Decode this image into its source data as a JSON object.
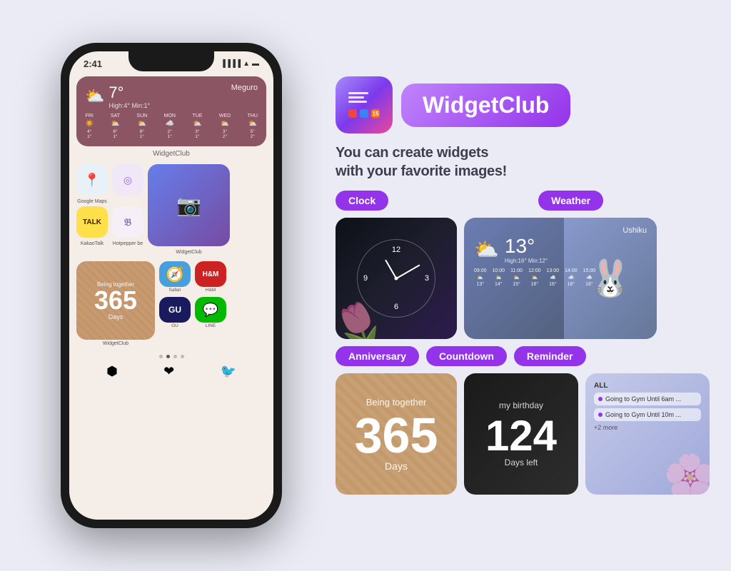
{
  "page": {
    "background_color": "#eaebf5"
  },
  "phone": {
    "time": "2:41",
    "weather_widget": {
      "temperature": "7°",
      "location": "Meguro",
      "high": "High:4°",
      "min": "Min:1°",
      "days": [
        {
          "name": "FRI",
          "icon": "☀",
          "high": "4°",
          "low": "1°"
        },
        {
          "name": "SAT",
          "icon": "⛅",
          "high": "6°",
          "low": "1°"
        },
        {
          "name": "SUN",
          "icon": "⛅",
          "high": "8°",
          "low": "1°"
        },
        {
          "name": "MON",
          "icon": "☁",
          "high": "2°",
          "low": "1°"
        },
        {
          "name": "TUE",
          "icon": "⛅",
          "high": "3°",
          "low": "1°"
        },
        {
          "name": "WED",
          "icon": "⛅",
          "high": "3°",
          "low": "2°"
        },
        {
          "name": "THU",
          "icon": "⛅",
          "high": "5°",
          "low": "2°"
        }
      ]
    },
    "widgetclub_label": "WidgetClub",
    "apps": [
      {
        "name": "Google Maps",
        "icon": "📍"
      },
      {
        "name": "KakaoTalk",
        "icon": "💬"
      },
      {
        "name": "Hotpepper be",
        "icon": "🌶"
      },
      {
        "name": "WidgetClub",
        "icon": "📱"
      }
    ],
    "anniversary_widget": {
      "being_together": "Being together",
      "days_number": "365",
      "days_label": "Days"
    },
    "small_apps": [
      {
        "name": "Safari",
        "icon": "🧭"
      },
      {
        "name": "H&M",
        "icon": "H&M"
      },
      {
        "name": "GU",
        "icon": "GU"
      },
      {
        "name": "LINE",
        "icon": "💬"
      }
    ]
  },
  "app_info": {
    "title": "WidgetClub",
    "tagline_line1": "You can create widgets",
    "tagline_line2": "with your favorite images!"
  },
  "categories": {
    "row1": [
      {
        "label": "Clock",
        "color": "badge-purple"
      },
      {
        "label": "Weather",
        "color": "badge-purple"
      }
    ],
    "row2": [
      {
        "label": "Anniversary",
        "color": "badge-purple"
      },
      {
        "label": "Countdown",
        "color": "badge-purple"
      },
      {
        "label": "Reminder",
        "color": "badge-purple"
      }
    ]
  },
  "clock_widget": {
    "hour_12": "12",
    "hour_3": "3",
    "hour_6": "6",
    "hour_9": "9"
  },
  "weather_preview": {
    "location": "Ushiku",
    "temperature": "13°",
    "high_low": "High:16° Min:12°",
    "hours": [
      {
        "time": "09:00",
        "icon": "⛅",
        "temp": "13°"
      },
      {
        "time": "10:00",
        "icon": "⛅",
        "temp": "14°"
      },
      {
        "time": "11:00",
        "icon": "⛅",
        "temp": "15°"
      },
      {
        "time": "12:00",
        "icon": "⛅",
        "temp": "16°"
      },
      {
        "time": "13:00",
        "icon": "☁",
        "temp": "16°"
      },
      {
        "time": "14:00",
        "icon": "☁",
        "temp": "16°"
      },
      {
        "time": "15:00",
        "icon": "☁",
        "temp": "16°"
      }
    ]
  },
  "anniversary_preview": {
    "being_together": "Being together",
    "number": "365",
    "days": "Days"
  },
  "countdown_preview": {
    "label": "my birthday",
    "number": "124",
    "days_left": "Days left"
  },
  "reminder_preview": {
    "all_label": "ALL",
    "items": [
      {
        "text": "Going to Gym Until 6am ..."
      },
      {
        "text": "Going to Gym Until 10m ..."
      }
    ],
    "more": "+2 more"
  }
}
